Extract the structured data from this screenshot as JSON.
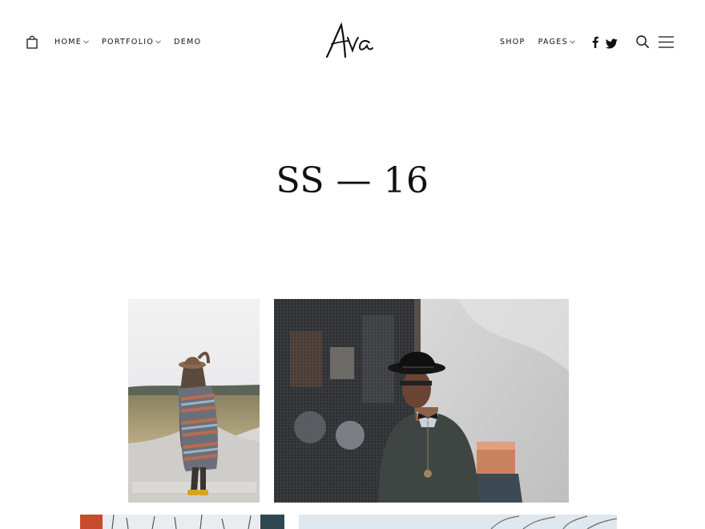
{
  "header": {
    "logo_text": "Ava",
    "nav_left": [
      {
        "label": "HOME",
        "dropdown": true
      },
      {
        "label": "PORTFOLIO",
        "dropdown": true
      },
      {
        "label": "DEMO",
        "dropdown": false
      }
    ],
    "nav_right": [
      {
        "label": "SHOP",
        "dropdown": false
      },
      {
        "label": "PAGES",
        "dropdown": true
      }
    ],
    "icons": [
      "shopping-bag-icon",
      "facebook-icon",
      "twitter-icon",
      "search-icon",
      "hamburger-menu-icon"
    ]
  },
  "page": {
    "title": "SS — 16"
  },
  "gallery": {
    "images": [
      {
        "subject": "woman with hat and striped blanket on gravel road"
      },
      {
        "subject": "man in black hat and bow tie by window"
      },
      {
        "subject": "bare trees against sky"
      },
      {
        "subject": "bare branches against sky"
      }
    ]
  },
  "colors": {
    "text": "#111111",
    "background": "#ffffff"
  }
}
